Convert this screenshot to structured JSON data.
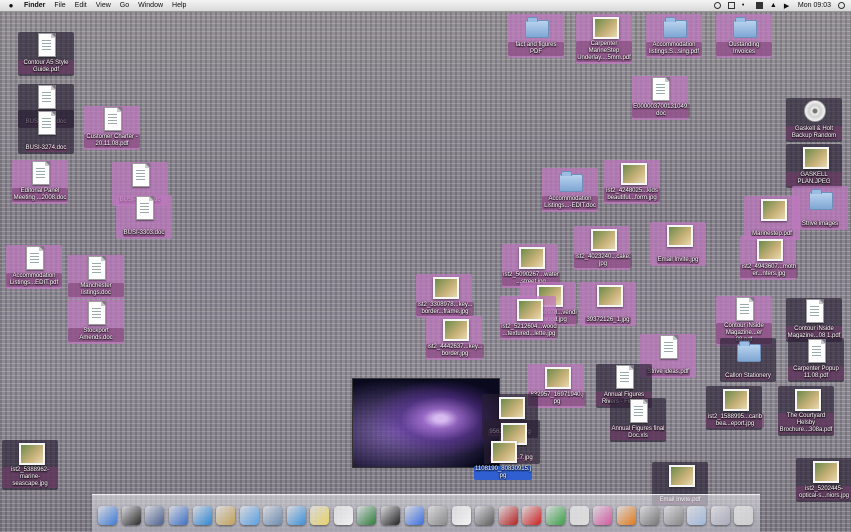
{
  "menubar": {
    "app": "Finder",
    "items": [
      "File",
      "Edit",
      "View",
      "Go",
      "Window",
      "Help"
    ],
    "clock": "Mon 09:03"
  },
  "desktop_icons": [
    {
      "id": "i01",
      "type": "doc",
      "label": "Contour A5 Style Guide.pdf"
    },
    {
      "id": "i02",
      "type": "doc",
      "label": "BUSI-3003.doc"
    },
    {
      "id": "i03",
      "type": "doc",
      "label": "BUSI-3274.doc"
    },
    {
      "id": "i04",
      "type": "doc",
      "label": "Customer Charter - 20.11.08.pdf"
    },
    {
      "id": "i05",
      "type": "doc",
      "label": "Editorial Panel Meeting ...2008.doc"
    },
    {
      "id": "i06",
      "type": "doc",
      "label": "BUSI-3302.doc"
    },
    {
      "id": "i07",
      "type": "doc",
      "label": "BUSI-3303.doc"
    },
    {
      "id": "i08",
      "type": "doc",
      "label": "Accommodation Listings...EDIT.pdf"
    },
    {
      "id": "i09",
      "type": "doc",
      "label": "Manchester listings.doc"
    },
    {
      "id": "i10",
      "type": "doc",
      "label": "Stockport Amends.doc"
    },
    {
      "id": "i11",
      "type": "folder",
      "label": "fact and figures PDF"
    },
    {
      "id": "i12",
      "type": "photo",
      "label": "Carpenter MarineStep Underlay....5mm.pdf"
    },
    {
      "id": "i13",
      "type": "folder",
      "label": "Accommodation listings.S...sing.pdf"
    },
    {
      "id": "i14",
      "type": "folder",
      "label": "Oustanding Invoices"
    },
    {
      "id": "i15",
      "type": "doc",
      "label": "E000003700131049.doc"
    },
    {
      "id": "i16",
      "type": "disc",
      "label": "Gaskell & Holt Backup Random"
    },
    {
      "id": "i17",
      "type": "photo",
      "label": "GASKELL PLAN.JPEG"
    },
    {
      "id": "i18",
      "type": "folder",
      "label": "Accommodation Listings...-EDIT.doc"
    },
    {
      "id": "i19",
      "type": "photo",
      "label": "ist2_4248025...kids beautiful...form.jpg"
    },
    {
      "id": "i20",
      "type": "photo",
      "label": "Marinestep.pdf"
    },
    {
      "id": "i21",
      "type": "folder",
      "label": "Strive images"
    },
    {
      "id": "i22",
      "type": "photo",
      "label": "Email Invite.jpg"
    },
    {
      "id": "i23",
      "type": "photo",
      "label": "ist2_4943607...mother...nters.jpg"
    },
    {
      "id": "i24",
      "type": "photo",
      "label": "ist2_4023240...cake.jpg"
    },
    {
      "id": "i25",
      "type": "photo",
      "label": "ist2_5090267...water...street.jpg"
    },
    {
      "id": "i26",
      "type": "photo",
      "label": "ist2_3308978...key...border...frame.jpg"
    },
    {
      "id": "i27",
      "type": "photo",
      "label": "ist2_2950978...vending...wood.jpg"
    },
    {
      "id": "i28",
      "type": "photo",
      "label": "ist2_5212604...wood...textured...lette.jpg"
    },
    {
      "id": "i29",
      "type": "photo",
      "label": "39372126_1.jpg"
    },
    {
      "id": "i30",
      "type": "photo",
      "label": "ist2_4442637...key...border.jpg"
    },
    {
      "id": "i31",
      "type": "doc",
      "label": "Contour iNside Magazine...er 08.pdf"
    },
    {
      "id": "i32",
      "type": "doc",
      "label": "Contour iNside Magazine...08 1.pdf"
    },
    {
      "id": "i33",
      "type": "doc",
      "label": "Strive ideas.pdf"
    },
    {
      "id": "i34",
      "type": "folder",
      "label": "Callon Stationery"
    },
    {
      "id": "i35",
      "type": "doc",
      "label": "Carpenter Popup 11.08.pdf"
    },
    {
      "id": "i36",
      "type": "photo",
      "label": "832957_16971940.jpg"
    },
    {
      "id": "i37",
      "type": "doc",
      "label": "Annual Figures Rivers - Final.xls"
    },
    {
      "id": "i38",
      "type": "doc",
      "label": "Annual Figures final Doc.xls"
    },
    {
      "id": "i39",
      "type": "photo",
      "label": "ist2_1588995...caribbea...eport.jpg"
    },
    {
      "id": "i40",
      "type": "photo",
      "label": "The Courtyard Helsby Brochure...308a.pdf"
    },
    {
      "id": "i41",
      "type": "photo",
      "label": "ist2_5388962-marine-seascape.jpg"
    },
    {
      "id": "i42",
      "type": "photo",
      "label": "956318_...1.jpg"
    },
    {
      "id": "i43",
      "type": "photo",
      "label": "956318_...7.jpg"
    },
    {
      "id": "i44",
      "type": "photo",
      "label": "1108190_80830915.jpg"
    },
    {
      "id": "i45",
      "type": "photo",
      "label": "ist2_5202445-optical-s...niors.jpg"
    },
    {
      "id": "i46",
      "type": "photo",
      "label": "Email Invite.pdf"
    }
  ],
  "dock": {
    "icons": [
      "finder",
      "dashboard",
      "preview",
      "ical-video",
      "safari",
      "mail-stamp",
      "itunes",
      "iphoto",
      "ichat",
      "sticky",
      "calendar",
      "time-machine",
      "photobooth",
      "app-store",
      "system-prefs",
      "textedit",
      "pen-tool",
      "acrobat",
      "acrobat-2",
      "graph",
      "grapher",
      "flower",
      "firefox",
      "misc-1",
      "misc-2",
      "documents-stack",
      "downloads-stack",
      "trash"
    ],
    "colors": [
      "#3f7bd6",
      "#2a2a2a",
      "#4a5f8f",
      "#3b6fc7",
      "#2e86d4",
      "#c2a25a",
      "#5aa0e0",
      "#6b8bb0",
      "#3d8fd7",
      "#e6d36a",
      "#f0f0f0",
      "#2d7c3a",
      "#222",
      "#3a6fe0",
      "#8a8a8a",
      "#f3f3f3",
      "#5d5d5d",
      "#b72020",
      "#c22",
      "#3aa048",
      "#ddd",
      "#d05a9f",
      "#e07a1a",
      "#777",
      "#888",
      "#9fb7d8",
      "#aab",
      "#cfcfcf"
    ]
  }
}
